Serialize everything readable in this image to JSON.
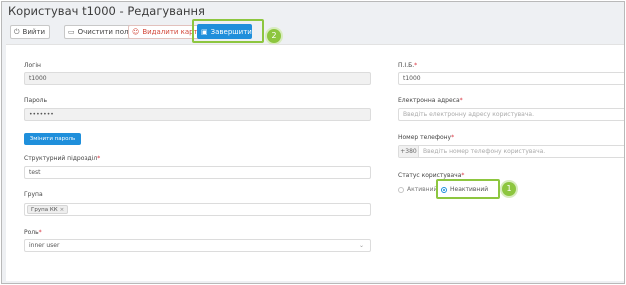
{
  "window": {
    "title": "Користувач t1000 - Редагування"
  },
  "toolbar": {
    "exit_label": "Вийти",
    "clear_label": "Очистити поля",
    "delete_label": "Видалити картку",
    "finish_label": "Завершити"
  },
  "callouts": {
    "finish": "2",
    "inactive": "1"
  },
  "form": {
    "login": {
      "label": "Логін",
      "value": "t1000"
    },
    "password": {
      "label": "Пароль",
      "value": "•••••••"
    },
    "change_password_label": "Змінити пароль",
    "department": {
      "label": "Структурний підрозділ",
      "required_mark": "*",
      "value": "test"
    },
    "group": {
      "label": "Група",
      "chip": "Група КК",
      "chip_remove": "×"
    },
    "role": {
      "label": "Роль",
      "required_mark": "*",
      "value": "inner user"
    },
    "full_name": {
      "label": "П.І.Б.",
      "required_mark": "*",
      "value": "t1000"
    },
    "email": {
      "label": "Електронна адреса",
      "required_mark": "*",
      "placeholder": "Введіть електронну адресу користувача."
    },
    "phone": {
      "label": "Номер телефону",
      "required_mark": "*",
      "prefix": "+380",
      "placeholder": "Введіть номер телефону користувача."
    },
    "status": {
      "label": "Статус користувача",
      "required_mark": "*",
      "options": [
        "Активний",
        "Неактивний"
      ],
      "selected": "Неактивний"
    }
  },
  "colors": {
    "accent": "#1f8fdb",
    "callout": "#8dc63f",
    "danger": "#d2473a"
  }
}
